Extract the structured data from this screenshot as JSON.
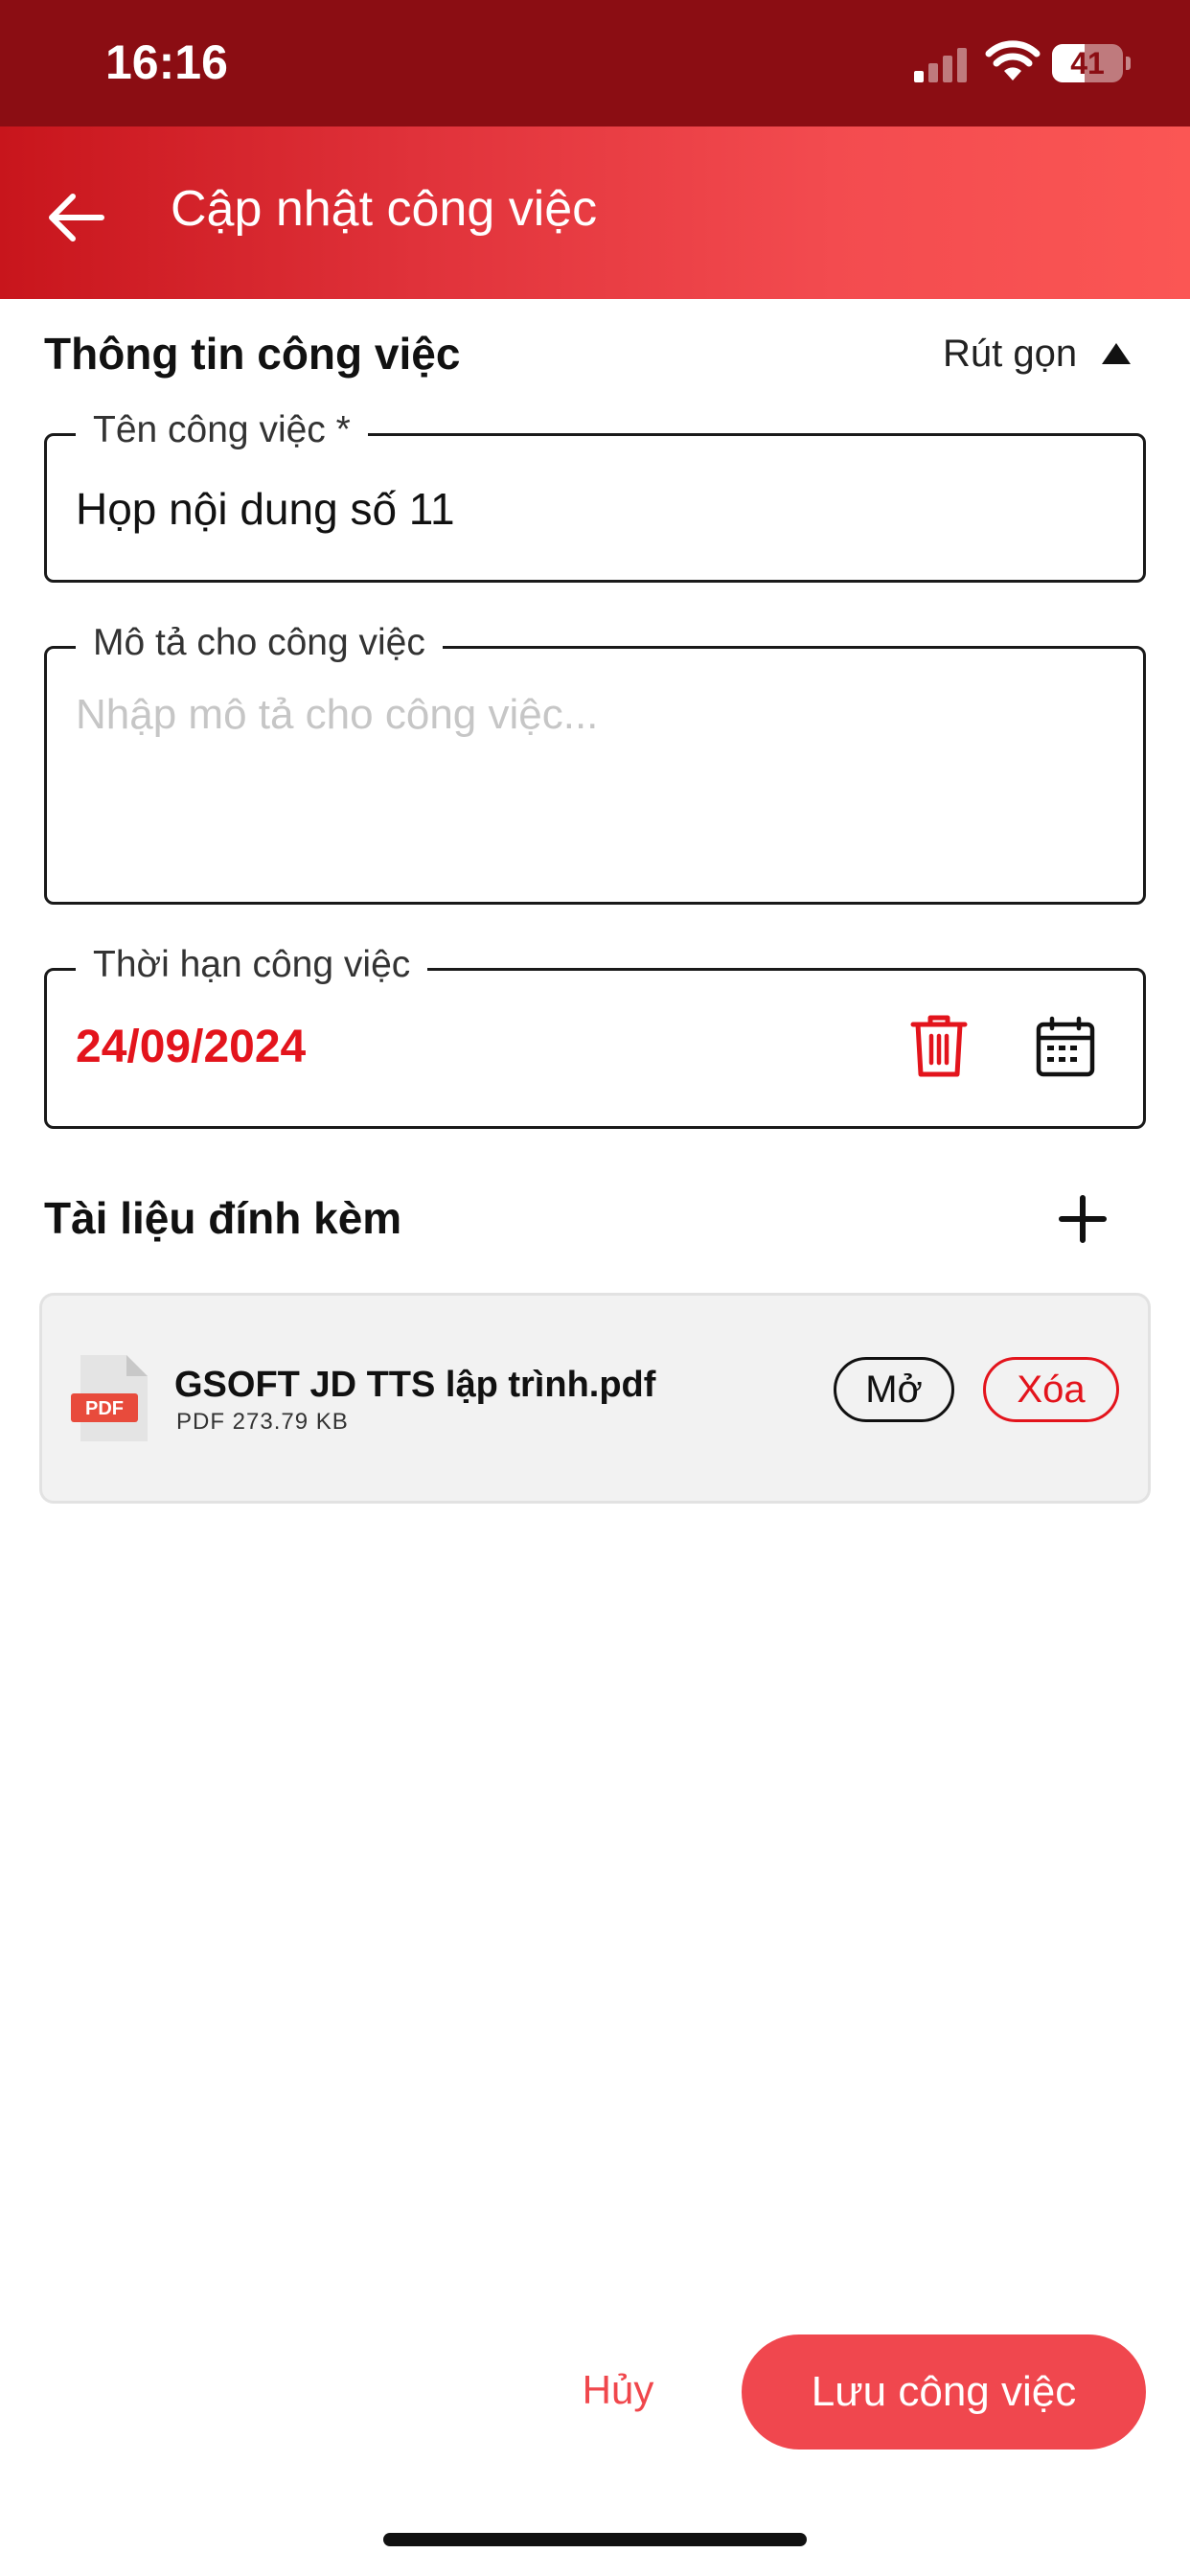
{
  "status_bar": {
    "time": "16:16",
    "battery": "41"
  },
  "header": {
    "title": "Cập nhật công việc",
    "back_icon": "arrow-left-icon"
  },
  "section": {
    "title": "Thông tin công việc",
    "collapse_label": "Rút gọn",
    "collapse_icon": "triangle-up-icon"
  },
  "fields": {
    "name": {
      "label": "Tên công việc *",
      "value": "Họp nội dung số 11"
    },
    "description": {
      "label": "Mô tả cho công việc",
      "value": "",
      "placeholder": "Nhập mô tả cho công việc..."
    },
    "deadline": {
      "label": "Thời hạn công việc",
      "value": "24/09/2024"
    }
  },
  "attachments": {
    "title": "Tài liệu đính kèm",
    "items": [
      {
        "name": "GSOFT JD TTS lập trình.pdf",
        "meta": "PDF 273.79 KB",
        "icon_text": "PDF",
        "open_label": "Mở",
        "delete_label": "Xóa"
      }
    ]
  },
  "actions": {
    "cancel_label": "Hủy",
    "save_label": "Lưu công việc"
  },
  "colors": {
    "status_bar": "#8b0d13",
    "accent": "#e3141c",
    "save_button": "#f0474e"
  }
}
